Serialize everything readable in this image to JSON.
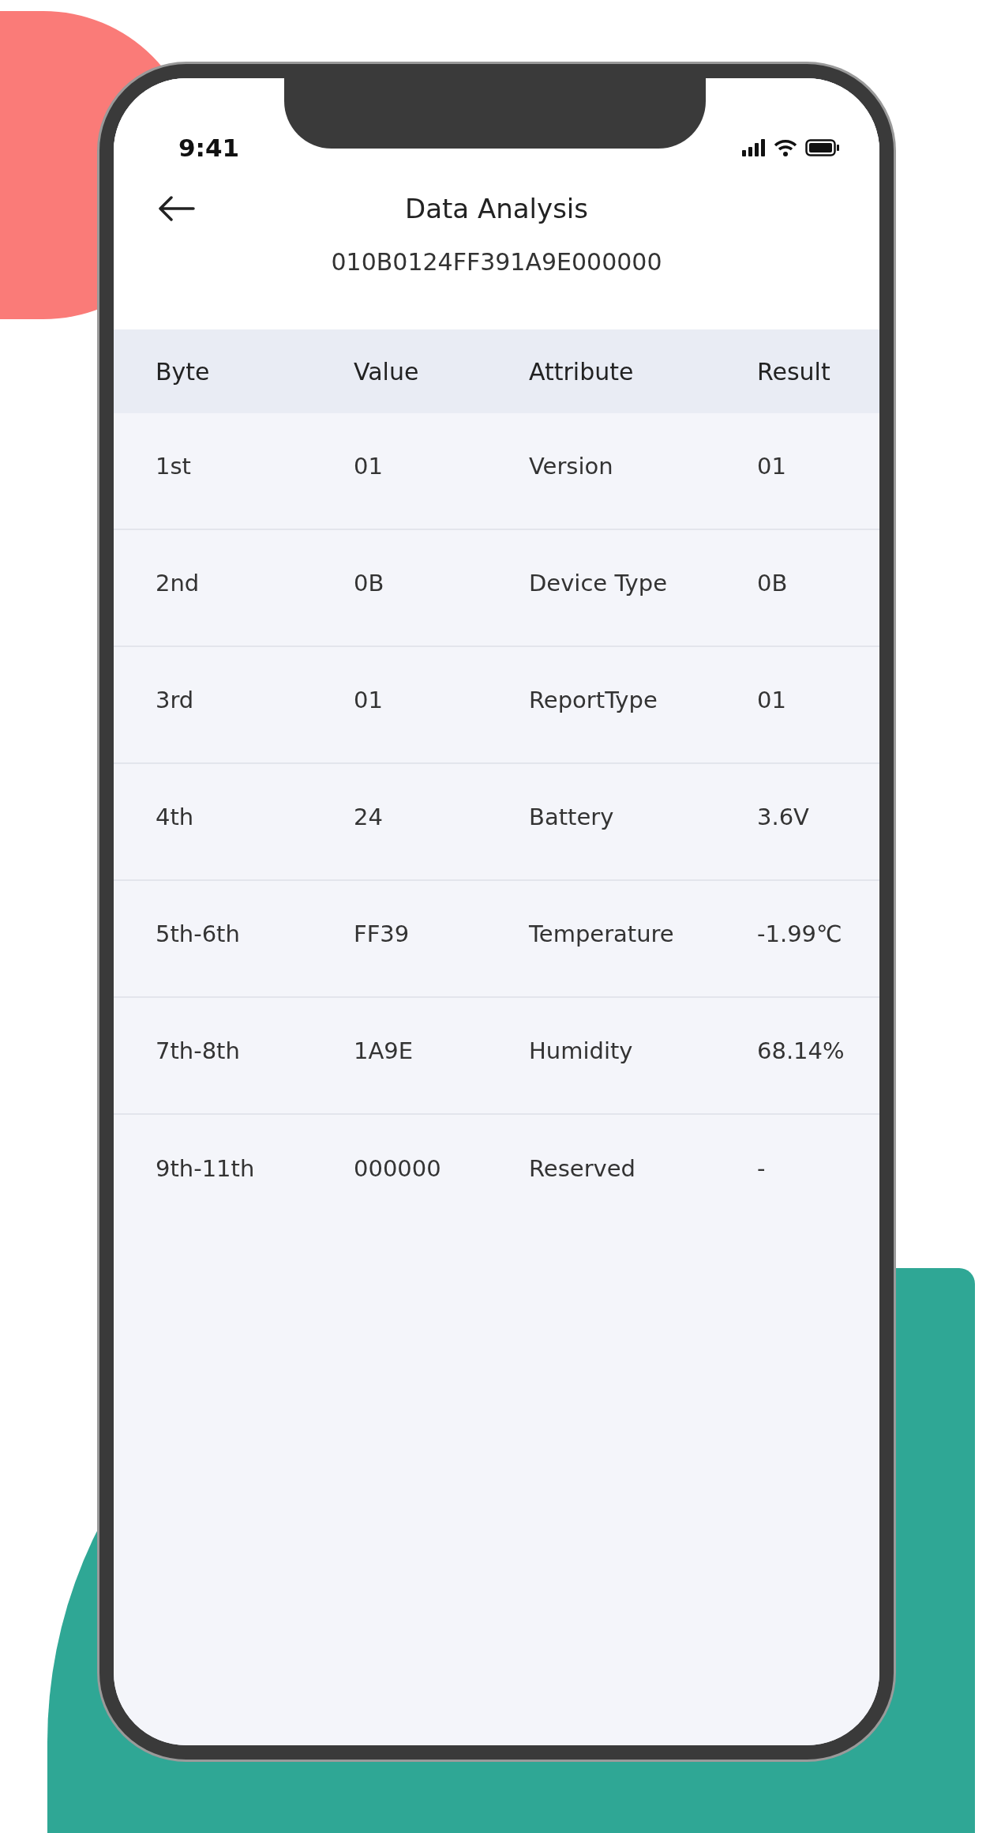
{
  "status_bar": {
    "time": "9:41"
  },
  "header": {
    "title": "Data Analysis",
    "subtitle": "010B0124FF391A9E000000"
  },
  "table": {
    "columns": [
      "Byte",
      "Value",
      "Attribute",
      "Result"
    ],
    "rows": [
      {
        "byte": "1st",
        "value": "01",
        "attribute": "Version",
        "result": "01"
      },
      {
        "byte": "2nd",
        "value": "0B",
        "attribute": "Device Type",
        "result": "0B"
      },
      {
        "byte": "3rd",
        "value": "01",
        "attribute": "ReportType",
        "result": "01"
      },
      {
        "byte": "4th",
        "value": "24",
        "attribute": "Battery",
        "result": "3.6V"
      },
      {
        "byte": "5th-6th",
        "value": "FF39",
        "attribute": "Temperature",
        "result": "-1.99℃"
      },
      {
        "byte": "7th-8th",
        "value": "1A9E",
        "attribute": "Humidity",
        "result": "68.14%"
      },
      {
        "byte": "9th-11th",
        "value": "000000",
        "attribute": "Reserved",
        "result": "-"
      }
    ]
  }
}
